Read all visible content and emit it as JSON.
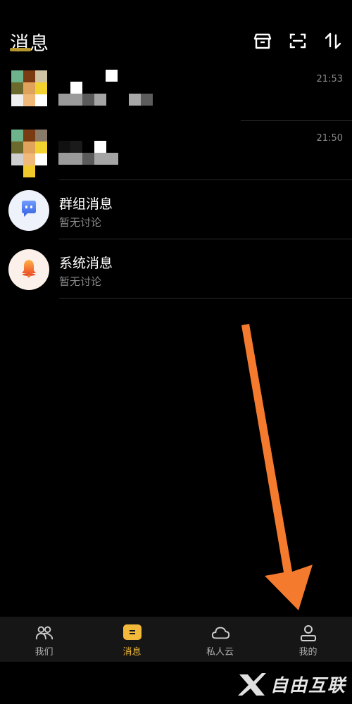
{
  "header": {
    "title": "消息",
    "icons": [
      "archive-icon",
      "scan-icon",
      "sort-icon"
    ]
  },
  "chats": [
    {
      "name": "",
      "preview": "",
      "time": "21:53",
      "avatar": "pixelated-avatar"
    },
    {
      "name": "",
      "preview": "",
      "time": "21:50",
      "avatar": "pixelated-avatar"
    },
    {
      "name": "群组消息",
      "preview": "暂无讨论",
      "time": "",
      "avatar": "group-chat-icon",
      "avatar_color": "#4b7cf0"
    },
    {
      "name": "系统消息",
      "preview": "暂无讨论",
      "time": "",
      "avatar": "bell-icon",
      "avatar_color": "#f07a2a"
    }
  ],
  "tabbar": {
    "tabs": [
      {
        "label": "我们",
        "icon": "people-icon",
        "active": false
      },
      {
        "label": "消息",
        "icon": "message-icon",
        "active": true
      },
      {
        "label": "私人云",
        "icon": "cloud-icon",
        "active": false
      },
      {
        "label": "我的",
        "icon": "profile-icon",
        "active": false
      }
    ]
  },
  "annotation": {
    "arrow_color": "#f47a2e",
    "points_to": "我的"
  },
  "watermark": {
    "text": "自由互联"
  },
  "colors": {
    "accent": "#f3b93a",
    "background": "#000000",
    "tabbar_bg": "#161616",
    "muted_text": "#8a8a8a"
  }
}
